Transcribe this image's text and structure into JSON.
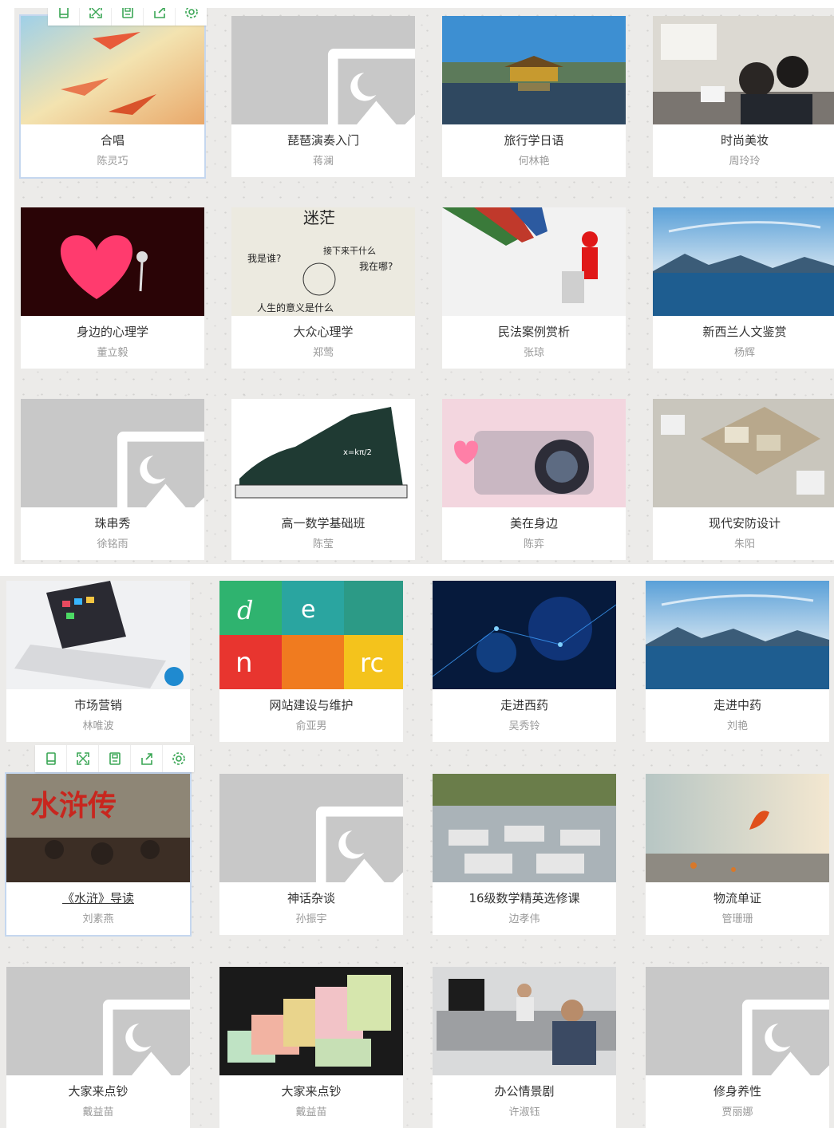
{
  "colors": {
    "toolbar_icon": "#3aa655",
    "placeholder_bg": "#c8c8c8",
    "title_text": "#333333",
    "teacher_text": "#999999"
  },
  "toolbar_icons": [
    "preview-icon",
    "fullscreen-icon",
    "save-icon",
    "share-icon",
    "settings-icon"
  ],
  "courses": [
    {
      "title": "合唱",
      "teacher": "陈灵巧",
      "thumb": "paper-planes"
    },
    {
      "title": "琵琶演奏入门",
      "teacher": "蒋澜",
      "thumb": "placeholder"
    },
    {
      "title": "旅行学日语",
      "teacher": "何林艳",
      "thumb": "golden-pavilion"
    },
    {
      "title": "时尚美妆",
      "teacher": "周玲玲",
      "thumb": "makeup-class"
    },
    {
      "title": "身边的心理学",
      "teacher": "董立毅",
      "thumb": "red-heart"
    },
    {
      "title": "大众心理学",
      "teacher": "郑莺",
      "thumb": "confusion-sketch"
    },
    {
      "title": "民法案例赏析",
      "teacher": "张琼",
      "thumb": "pencils-speaker"
    },
    {
      "title": "新西兰人文鉴赏",
      "teacher": "杨辉",
      "thumb": "lake-landscape"
    },
    {
      "title": "珠串秀",
      "teacher": "徐铭雨",
      "thumb": "placeholder"
    },
    {
      "title": "高一数学基础班",
      "teacher": "陈莹",
      "thumb": "math-sneaker"
    },
    {
      "title": "美在身边",
      "teacher": "陈弈",
      "thumb": "pink-camera"
    },
    {
      "title": "现代安防设计",
      "teacher": "朱阳",
      "thumb": "floor-plan"
    },
    {
      "title": "市场营销",
      "teacher": "林唯波",
      "thumb": "laptop-apps"
    },
    {
      "title": "网站建设与维护",
      "teacher": "俞亚男",
      "thumb": "color-tiles"
    },
    {
      "title": "走进西药",
      "teacher": "吴秀铃",
      "thumb": "blue-tech"
    },
    {
      "title": "走进中药",
      "teacher": "刘艳",
      "thumb": "lake-landscape"
    },
    {
      "title": "《水浒》导读",
      "teacher": "刘素燕",
      "thumb": "water-margin"
    },
    {
      "title": "神话杂谈",
      "teacher": "孙振宇",
      "thumb": "placeholder"
    },
    {
      "title": "16级数学精英选修课",
      "teacher": "边孝伟",
      "thumb": "classroom"
    },
    {
      "title": "物流单证",
      "teacher": "管珊珊",
      "thumb": "autumn-leaf"
    },
    {
      "title": "大家来点钞",
      "teacher": "戴益苗",
      "thumb": "placeholder"
    },
    {
      "title": "大家来点钞",
      "teacher": "戴益苗",
      "thumb": "money-stacks"
    },
    {
      "title": "办公情景剧",
      "teacher": "许淑钰",
      "thumb": "office-scene"
    },
    {
      "title": "修身养性",
      "teacher": "贾丽娜",
      "thumb": "placeholder"
    }
  ],
  "thumb_text": {
    "confusion-sketch": [
      "迷茫",
      "我是谁?",
      "我在哪?",
      "接下来干什么",
      "人生的意义是什么"
    ],
    "water-margin": "水浒传"
  }
}
